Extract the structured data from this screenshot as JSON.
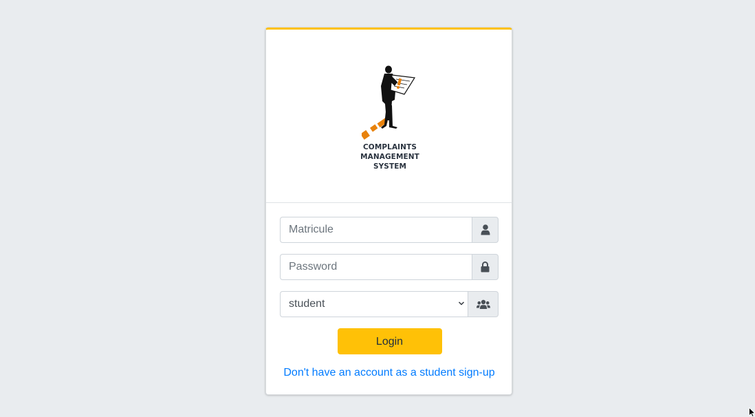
{
  "logo": {
    "line1": "COMPLAINTS MANAGEMENT",
    "line2": "SYSTEM"
  },
  "form": {
    "matricule_placeholder": "Matricule",
    "matricule_value": "",
    "password_placeholder": "Password",
    "password_value": "",
    "role_selected": "student",
    "login_label": "Login",
    "signup_link": "Don't have an account as a student sign-up"
  },
  "icons": {
    "matricule": "user-icon",
    "password": "lock-icon",
    "role": "users-icon",
    "select": "chevron-down-icon"
  },
  "colors": {
    "accent": "#ffc107",
    "link": "#007bff",
    "background": "#e9ecef",
    "logo_orange": "#e8820c"
  }
}
